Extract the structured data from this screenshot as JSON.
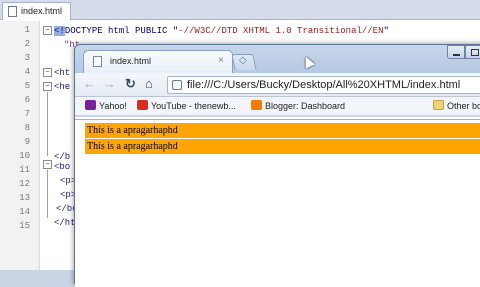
{
  "editor": {
    "tab_label": "index.html",
    "line_numbers": [
      "1",
      "2",
      "3",
      "4",
      "5",
      "6",
      "7",
      "8",
      "9",
      "10",
      "11",
      "12",
      "13",
      "14",
      "15"
    ],
    "line1_prefix": "<!",
    "line1_doctype": "DOCTYPE html PUBLIC \"",
    "line1_string": "-//W3C//DTD XHTML 1.0 Transitional//EN",
    "line1_suffix": "\"",
    "line2": "\"ht",
    "line4": "<ht",
    "line5": "<he",
    "line10": "</b",
    "line11": "<bo",
    "line12": "<p>",
    "line13": "<p>",
    "line14": "</bo",
    "line15": "</ht"
  },
  "browser": {
    "tab_title": "index.html",
    "tab_close": "×",
    "address": "file:///C:/Users/Bucky/Desktop/All%20XHTML/index.html",
    "bookmarks": [
      {
        "label": "Yahoo!"
      },
      {
        "label": "YouTube - thenewb..."
      },
      {
        "label": "Blogger: Dashboard"
      },
      {
        "label": "Other bo"
      }
    ],
    "paragraphs": [
      "This is a apragarhaphd",
      "This is a apragarhaphd"
    ],
    "paragraph_bg": "#ffa500"
  }
}
